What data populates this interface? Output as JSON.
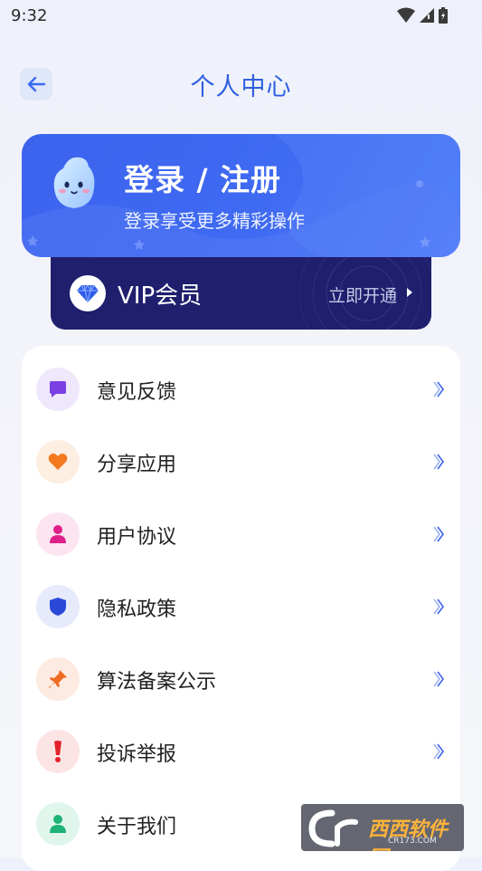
{
  "status_bar": {
    "time": "9:32"
  },
  "header": {
    "title": "个人中心",
    "back_icon": "arrow-left-icon"
  },
  "login_card": {
    "title": "登录 / 注册",
    "subtitle": "登录享受更多精彩操作"
  },
  "vip": {
    "label": "VIP会员",
    "action": "立即开通"
  },
  "menu": {
    "items": [
      {
        "label": "意见反馈",
        "icon": "message-icon",
        "color": "#7b3fe4",
        "bg": "#efe7fb"
      },
      {
        "label": "分享应用",
        "icon": "heart-icon",
        "color": "#f47a1f",
        "bg": "#fdeee2"
      },
      {
        "label": "用户协议",
        "icon": "user-icon",
        "color": "#e0208a",
        "bg": "#fce5f1"
      },
      {
        "label": "隐私政策",
        "icon": "shield-icon",
        "color": "#2a48d8",
        "bg": "#e6eafb"
      },
      {
        "label": "算法备案公示",
        "icon": "pin-icon",
        "color": "#f06a23",
        "bg": "#fdebe1"
      },
      {
        "label": "投诉举报",
        "icon": "exclamation-icon",
        "color": "#e3212b",
        "bg": "#fce4e4"
      },
      {
        "label": "关于我们",
        "icon": "person-icon",
        "color": "#1fb377",
        "bg": "#e0f6ec"
      }
    ]
  },
  "watermark": {
    "text": "西西软件园",
    "sub": "CR173.COM"
  },
  "colors": {
    "accent": "#3c63ee",
    "vip_bg": "#1f1f6e",
    "title": "#2f5fe0"
  }
}
